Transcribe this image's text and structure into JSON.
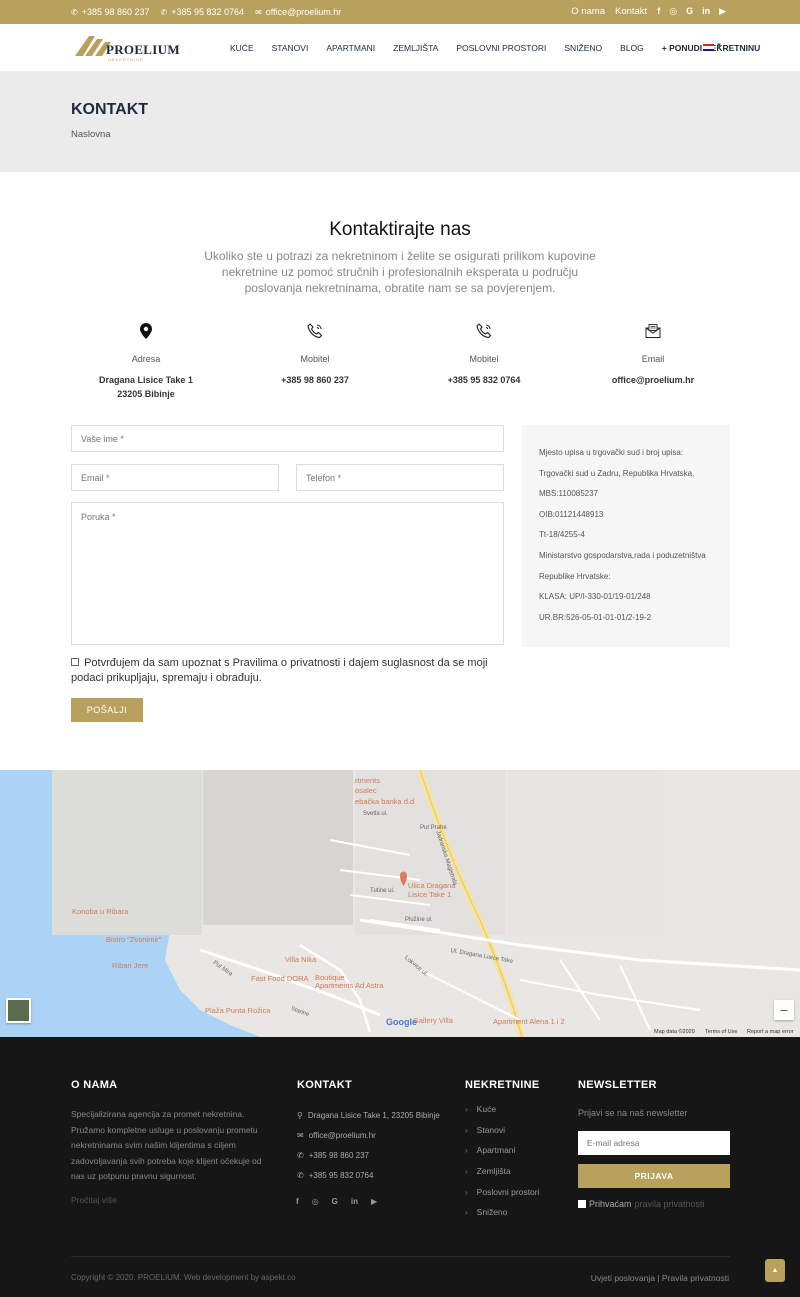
{
  "topbar": {
    "phone1": "+385 98 860 237",
    "phone2": "+385 95 832 0764",
    "email": "office@proelium.hr",
    "about_link": "O nama",
    "contact_link": "Kontakt",
    "social": [
      "f",
      "◎",
      "G",
      "in",
      "▶"
    ]
  },
  "header": {
    "logo_text": "PROELIUM",
    "logo_sub": "NEKRETNINE",
    "nav": [
      "KUĆE",
      "STANOVI",
      "APARTMANI",
      "ZEMLJIŠTA",
      "POSLOVNI PROSTORI",
      "SNIŽENO",
      "BLOG",
      "+ PONUDI NEKRETNINU"
    ],
    "colors": {
      "accent": "#b7a15c",
      "dark": "#1f2a3a"
    }
  },
  "titleband": {
    "title": "KONTAKT",
    "breadcrumb": "Naslovna"
  },
  "contact": {
    "title": "Kontaktirajte nas",
    "lead": "Ukoliko ste u potrazi za nekretninom i želite se osigurati prilikom kupovine nekretnine uz pomoć stručnih i profesionalnih eksperata u području poslovanja nekretninama, obratite nam se sa povjerenjem.",
    "items": [
      {
        "icon": "location-pin-icon",
        "label": "Adresa",
        "value_line1": "Dragana Lisice Take 1",
        "value_line2": "23205 Bibinje"
      },
      {
        "icon": "phone-icon",
        "label": "Mobitel",
        "value_line1": "+385 98 860 237",
        "value_line2": ""
      },
      {
        "icon": "phone-icon",
        "label": "Mobitel",
        "value_line1": "+385 95 832 0764",
        "value_line2": ""
      },
      {
        "icon": "envelope-icon",
        "label": "Email",
        "value_line1": "office@proelium.hr",
        "value_line2": ""
      }
    ]
  },
  "form": {
    "name_placeholder": "Vaše ime *",
    "email_placeholder": "Email *",
    "phone_placeholder": "Telefon *",
    "message_placeholder": "Poruka *",
    "consent": "Potvrđujem da sam upoznat s Pravilima o privatnosti i dajem suglasnost da se moji podaci prikupljaju, spremaju i obrađuju.",
    "submit": "POŠALJI"
  },
  "registry": [
    "Mjesto upisa u trgovački sud i broj upisa:",
    "Trgovački sud u Zadru, Republika Hrvatska.",
    "MBS:110085237",
    "OIB:01121448913",
    "Tt-18/4255-4",
    "Ministarstvo gospodarstva,rada i poduzetništva",
    "Republike Hrvatske:",
    "KLASA: UP/I-330-01/19-01/248",
    "UR.BR:526-05-01-01-01/2-19-2"
  ],
  "map": {
    "pin_label_1": "Ulica Dragana",
    "pin_label_2": "Lisice Take 1",
    "pois": [
      "Konoba u Ribara",
      "Bistro \"Zvonimir\"",
      "Riban Jere",
      "Villa Nika",
      "Fast Food DORA",
      "Boutique",
      "Apartments Ad Astra",
      "Plaža Punta Rožica",
      "Gallery Villa",
      "Apartment Alena 1 i 2",
      "rtments",
      "osalec",
      "ebačka banka d.d"
    ],
    "streets": [
      "Jadranska Magistrala",
      "Put Prahe",
      "Put Mira",
      "Starine",
      "Ul. Dragana Lisice Take",
      "Lokvice ul.",
      "Tutine ul.",
      "Plužine ul.",
      "Svetla ul."
    ],
    "google": "Google",
    "credits": [
      "Map data ©2020",
      "Terms of Use",
      "Report a map error"
    ],
    "zoom": "−"
  },
  "footer": {
    "about_title": "O NAMA",
    "about_text": "Specijalizirana agencija za promet nekretnina. Pružamo kompletne usluge u poslovanju prometu nekretninama svim našim klijentima s ciljem zadovoljavanja svih potreba koje klijent očekuje od nas uz potpunu pravnu sigurnost.",
    "read_more": "Pročitaj više",
    "contact_title": "KONTAKT",
    "contact_items": [
      {
        "icon": "location-pin-icon",
        "glyph": "⚲",
        "text": "Dragana Lisice Take 1, 23205 Bibinje"
      },
      {
        "icon": "envelope-icon",
        "glyph": "✉",
        "text": "office@proelium.hr"
      },
      {
        "icon": "phone-icon",
        "glyph": "✆",
        "text": "+385 98 860 237"
      },
      {
        "icon": "phone-icon",
        "glyph": "✆",
        "text": "+385 95 832 0764"
      }
    ],
    "social": [
      "f",
      "◎",
      "G",
      "in",
      "▶"
    ],
    "properties_title": "NEKRETNINE",
    "properties": [
      "Kuće",
      "Stanovi",
      "Apartmani",
      "Zemljišta",
      "Poslovni prostori",
      "Sniženo"
    ],
    "newsletter_title": "NEWSLETTER",
    "newsletter_sub": "Prijavi se na naš newsletter",
    "newsletter_placeholder": "E-mail adresa",
    "newsletter_button": "PRIJAVA",
    "accept_text": "Prihvaćam",
    "accept_link": "pravila privatnosti",
    "copyright": "Copyright © 2020. PROELIUM. Web development by aspekt.co",
    "legal": "Uvjeti poslovanja | Pravila privatnosti"
  }
}
